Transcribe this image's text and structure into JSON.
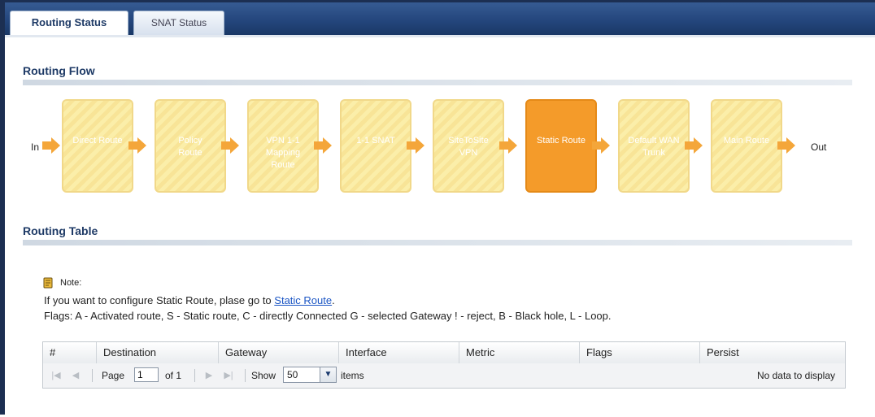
{
  "tabs": [
    {
      "label": "Routing Status",
      "active": true
    },
    {
      "label": "SNAT Status",
      "active": false
    }
  ],
  "routing_flow": {
    "title": "Routing Flow",
    "start_label": "In",
    "end_label": "Out",
    "steps": [
      {
        "lines": [
          "Direct Route"
        ],
        "active": false
      },
      {
        "lines": [
          "Policy",
          "Route"
        ],
        "active": false
      },
      {
        "lines": [
          "VPN 1-1",
          "Mapping",
          "Route"
        ],
        "active": false
      },
      {
        "lines": [
          "1-1 SNAT"
        ],
        "active": false
      },
      {
        "lines": [
          "SiteToSite",
          "VPN"
        ],
        "active": false
      },
      {
        "lines": [
          "Static Route"
        ],
        "active": true
      },
      {
        "lines": [
          "Default WAN",
          "Trunk"
        ],
        "active": false
      },
      {
        "lines": [
          "Main Route"
        ],
        "active": false
      }
    ],
    "colors": {
      "step": "#fbeea9",
      "active_step": "#f49b2a",
      "arrow": "#f4a63a"
    }
  },
  "routing_table": {
    "title": "Routing Table",
    "note": {
      "label": "Note:",
      "line1_prefix": "If you want to configure Static Route, plase go to ",
      "line1_link": "Static Route",
      "line1_suffix": ".",
      "line2": "Flags: A - Activated route, S - Static route, C - directly Connected G - selected Gateway ! - reject, B - Black hole, L - Loop."
    },
    "columns": [
      "#",
      "Destination",
      "Gateway",
      "Interface",
      "Metric",
      "Flags",
      "Persist"
    ],
    "rows": [],
    "pager": {
      "page_label": "Page",
      "page_value": "1",
      "of_label": "of 1",
      "show_label": "Show",
      "page_size": "50",
      "items_label": "items",
      "empty_text": "No data to display"
    }
  }
}
